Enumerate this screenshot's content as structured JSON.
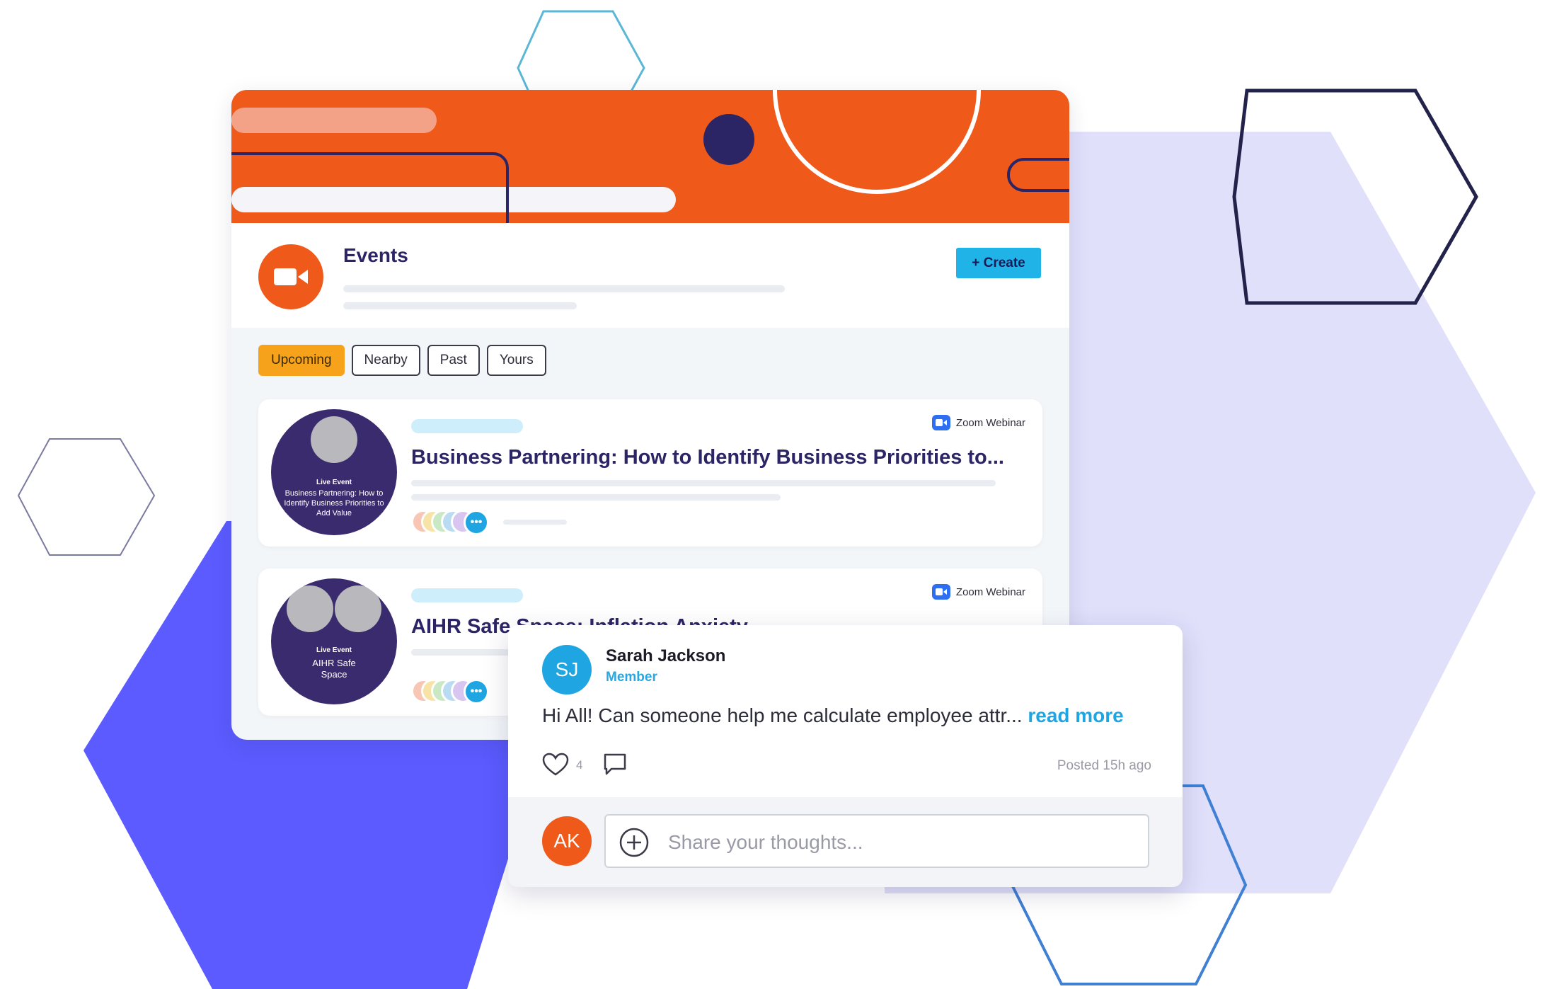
{
  "events": {
    "title": "Events",
    "create_label": "+ Create",
    "tabs": [
      {
        "label": "Upcoming",
        "active": true
      },
      {
        "label": "Nearby",
        "active": false
      },
      {
        "label": "Past",
        "active": false
      },
      {
        "label": "Yours",
        "active": false
      }
    ],
    "items": [
      {
        "platform": "Zoom Webinar",
        "title": "Business Partnering: How to Identify Business Priorities to...",
        "thumb_caption_top": "Live Event",
        "thumb_caption": "Business Partnering: How to Identify Business Priorities to Add Value"
      },
      {
        "platform": "Zoom Webinar",
        "title": "AIHR Safe Space: Inflation Anxiety",
        "thumb_caption_top": "Live Event",
        "thumb_caption": "AIHR Safe Space"
      }
    ]
  },
  "post": {
    "author_initials": "SJ",
    "author_name": "Sarah Jackson",
    "author_role": "Member",
    "text": "Hi All! Can someone help me calculate employee attr...",
    "read_more": "read more",
    "like_count": "4",
    "posted": "Posted 15h ago",
    "commenter_initials": "AK",
    "comment_placeholder": "Share your thoughts..."
  },
  "colors": {
    "brand_orange": "#ef5a1b",
    "navy": "#2b2566",
    "accent_blue": "#1fa6e2",
    "tab_active": "#f7a21b",
    "hex_purple": "#5b5bff",
    "hex_lavender": "#e0e0fb"
  }
}
